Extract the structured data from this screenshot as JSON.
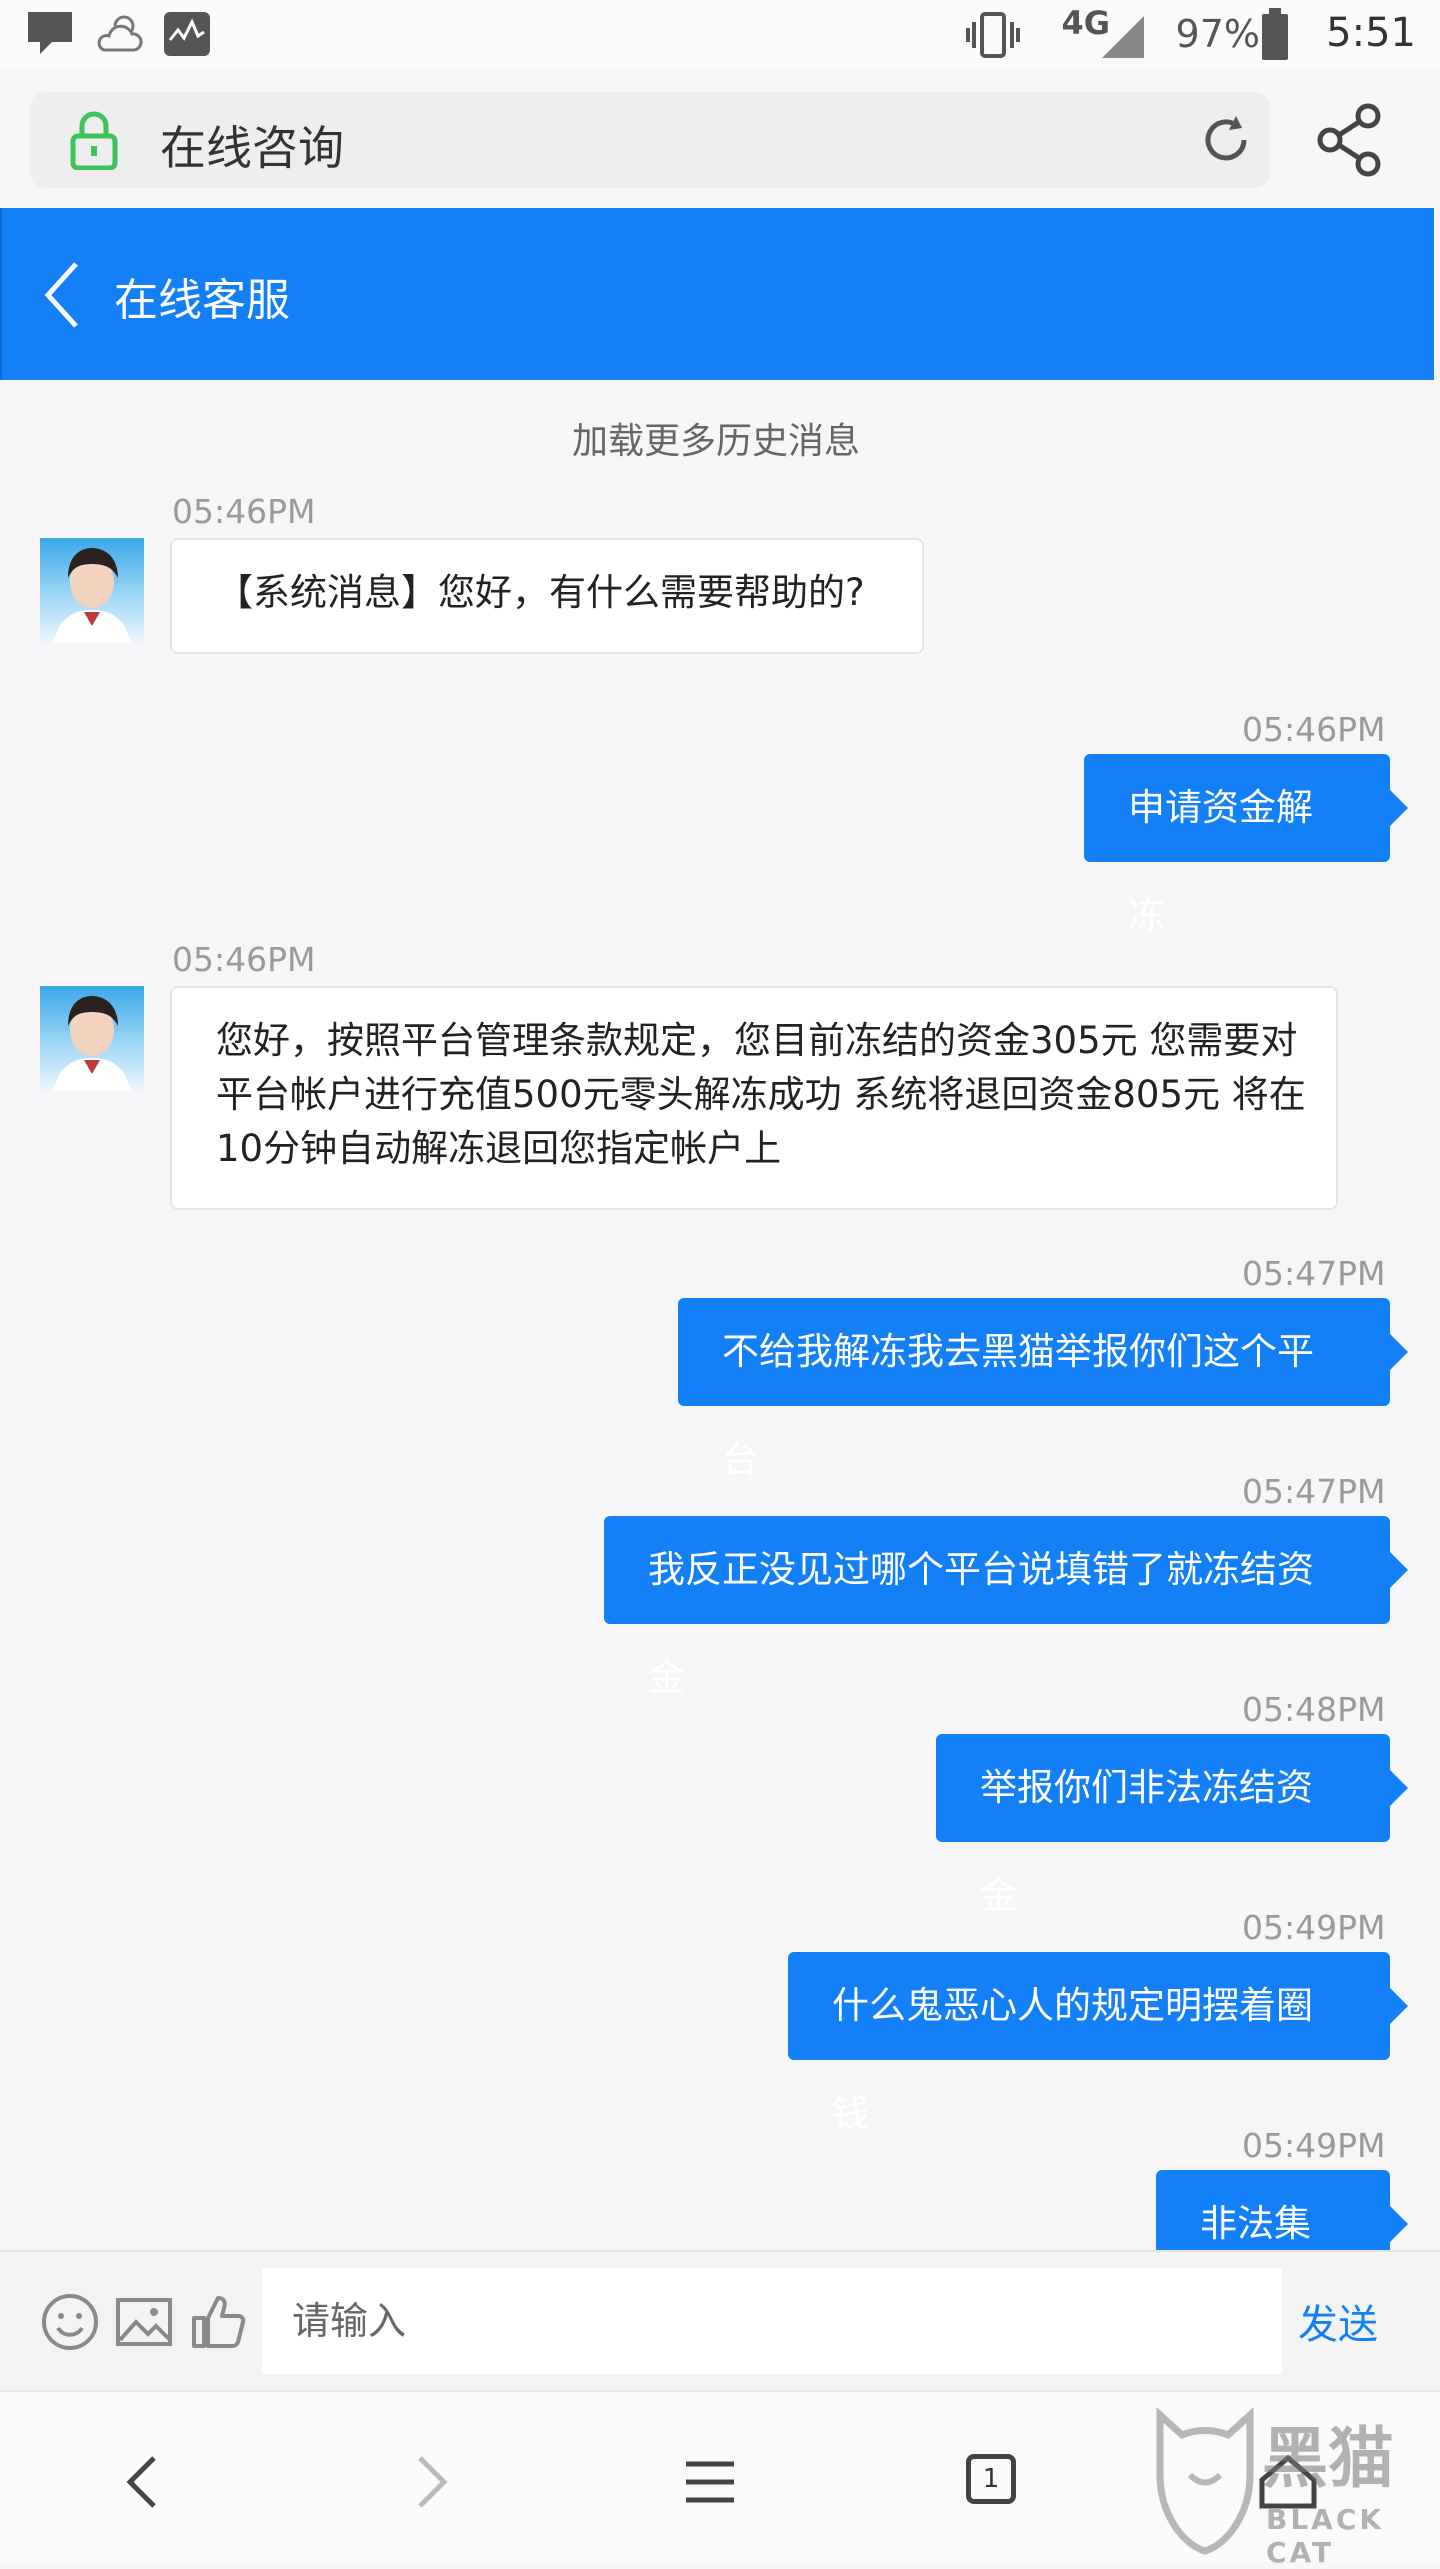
{
  "status_bar": {
    "network": "4G",
    "battery": "97%",
    "time": "5:51"
  },
  "browser": {
    "page_title": "在线咨询"
  },
  "app_header": {
    "title": "在线客服"
  },
  "chat": {
    "load_more": "加载更多历史消息",
    "messages": [
      {
        "from": "agent",
        "time": "05:46PM",
        "text": "【系统消息】您好，有什么需要帮助的?"
      },
      {
        "from": "user",
        "time": "05:46PM",
        "text": "申请资金解冻"
      },
      {
        "from": "agent",
        "time": "05:46PM",
        "lines": [
          "您好，按照平台管理条款规定，您目前冻结的资金305元 您需要对",
          "平台帐户进行充值500元零头解冻成功 系统将退回资金805元 将在",
          "10分钟自动解冻退回您指定帐户上"
        ]
      },
      {
        "from": "user",
        "time": "05:47PM",
        "text": "不给我解冻我去黑猫举报你们这个平台"
      },
      {
        "from": "user",
        "time": "05:47PM",
        "text": "我反正没见过哪个平台说填错了就冻结资金"
      },
      {
        "from": "user",
        "time": "05:48PM",
        "text": "举报你们非法冻结资金"
      },
      {
        "from": "user",
        "time": "05:49PM",
        "text": "什么鬼恶心人的规定明摆着圈钱"
      },
      {
        "from": "user",
        "time": "05:49PM",
        "text": "非法集资"
      }
    ]
  },
  "composer": {
    "placeholder": "请输入",
    "send_label": "发送"
  },
  "bottom_nav": {
    "tab_count": "1"
  },
  "watermark": {
    "text": "黑猫",
    "subtext": "BLACK CAT"
  },
  "colors": {
    "brand_blue": "#1380f7",
    "lock_green": "#3cc35a"
  }
}
